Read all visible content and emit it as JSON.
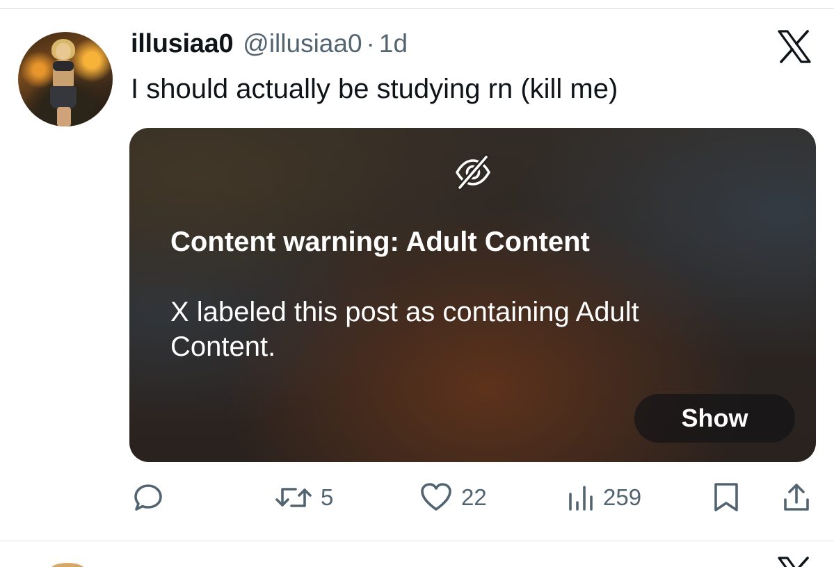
{
  "tweet": {
    "display_name": "illusiaa0",
    "handle": "@illusiaa0",
    "separator": "·",
    "time": "1d",
    "text": "I should actually be studying rn (kill me)",
    "avatar_icon": "profile-photo"
  },
  "media_warning": {
    "icon": "eye-slash-icon",
    "title": "Content warning: Adult Content",
    "body": "X labeled this post as containing Adult Content.",
    "show_label": "Show"
  },
  "actions": {
    "reply": {
      "icon": "reply-bubble-icon",
      "count": ""
    },
    "repost": {
      "icon": "repost-arrows-icon",
      "count": "5"
    },
    "like": {
      "icon": "heart-icon",
      "count": "22"
    },
    "views": {
      "icon": "bar-chart-icon",
      "count": "259"
    },
    "bookmark": {
      "icon": "bookmark-icon"
    },
    "share": {
      "icon": "share-upload-icon"
    }
  },
  "colors": {
    "text_primary": "#0f1419",
    "text_secondary": "#536471",
    "divider": "#e1e5e8"
  }
}
